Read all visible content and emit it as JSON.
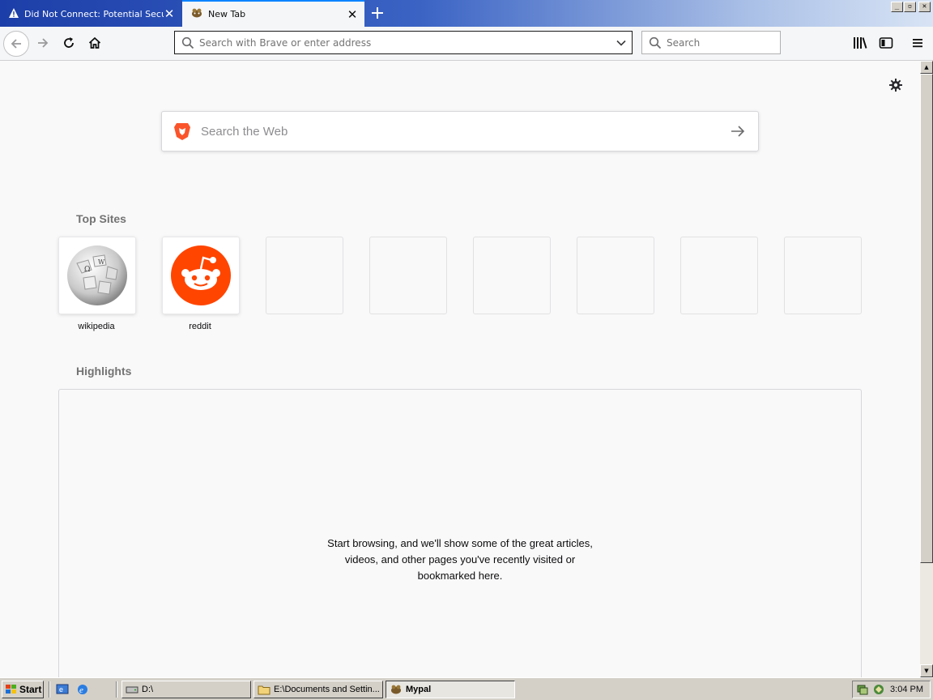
{
  "browser": {
    "tabs": [
      {
        "title": "Did Not Connect: Potential Securit",
        "active": false
      },
      {
        "title": "New Tab",
        "active": true
      }
    ],
    "window_buttons": {
      "minimize": "_",
      "maximize": "▫",
      "close": "✕"
    },
    "url_placeholder": "Search with Brave or enter address",
    "search_placeholder": "Search",
    "accent_color": "#0a84ff"
  },
  "newtab": {
    "web_search_placeholder": "Search the Web",
    "top_sites_title": "Top Sites",
    "top_sites": [
      {
        "label": "wikipedia",
        "icon": "wikipedia-globe-icon"
      },
      {
        "label": "reddit",
        "icon": "reddit-icon"
      },
      {
        "label": ""
      },
      {
        "label": ""
      },
      {
        "label": ""
      },
      {
        "label": ""
      },
      {
        "label": ""
      },
      {
        "label": ""
      }
    ],
    "highlights_title": "Highlights",
    "highlights_empty": [
      "Start browsing, and we'll show some of the great articles,",
      "videos, and other pages you've recently visited or",
      "bookmarked here."
    ]
  },
  "taskbar": {
    "start_label": "Start",
    "tasks": [
      {
        "label": "D:\\",
        "active": false
      },
      {
        "label": "E:\\Documents and Settin...",
        "active": false
      },
      {
        "label": "Mypal",
        "active": true
      }
    ],
    "clock": "3:04 PM"
  }
}
